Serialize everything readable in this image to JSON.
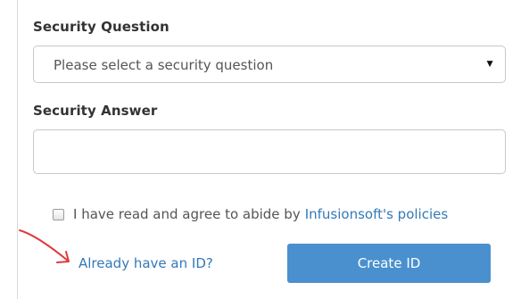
{
  "form": {
    "security_question": {
      "label": "Security Question",
      "placeholder": "Please select a security question",
      "caret_icon": "triangle-down-icon"
    },
    "security_answer": {
      "label": "Security Answer",
      "value": ""
    },
    "agreement": {
      "checked": false,
      "text": "I have read and agree to abide by",
      "link_text": "Infusionsoft's policies"
    },
    "already_link": "Already have an ID?",
    "create_button": "Create ID"
  },
  "annotation": {
    "icon": "red-arrow-icon",
    "color": "#e03a3a"
  },
  "colors": {
    "link": "#3479b7",
    "button_bg": "#4a90cf",
    "label": "#333333"
  }
}
